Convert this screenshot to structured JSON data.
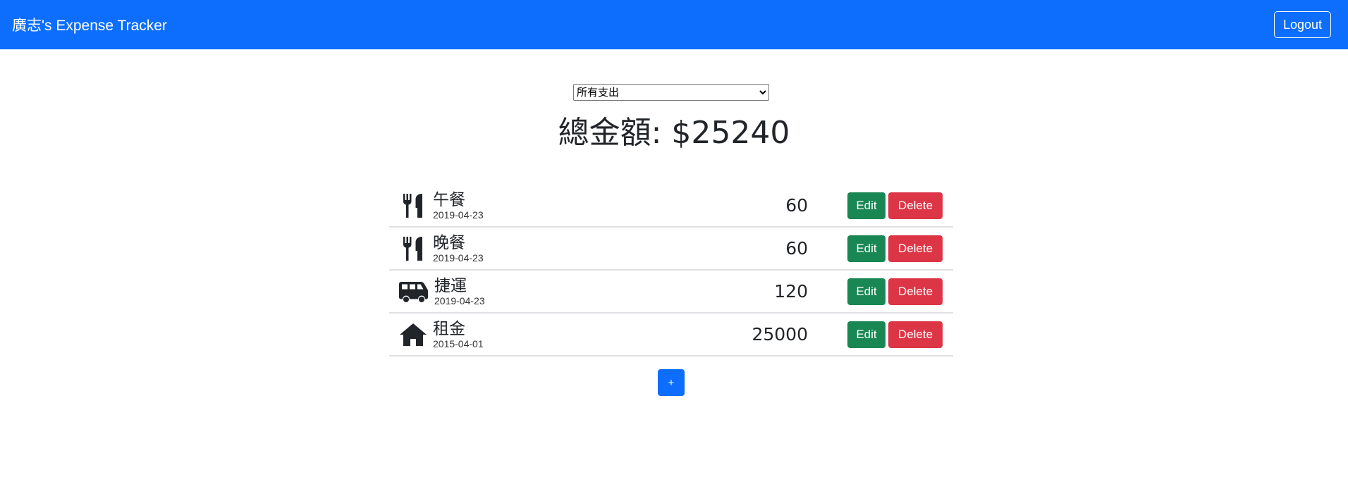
{
  "navbar": {
    "brand": "廣志's Expense Tracker",
    "logout_label": "Logout"
  },
  "filter": {
    "selected": "所有支出"
  },
  "total": {
    "text": "總金額: $25240"
  },
  "records": [
    {
      "icon": "utensils-icon",
      "name": "午餐",
      "date": "2019-04-23",
      "amount": "60",
      "edit_label": "Edit",
      "delete_label": "Delete"
    },
    {
      "icon": "utensils-icon",
      "name": "晚餐",
      "date": "2019-04-23",
      "amount": "60",
      "edit_label": "Edit",
      "delete_label": "Delete"
    },
    {
      "icon": "shuttle-van-icon",
      "name": "捷運",
      "date": "2019-04-23",
      "amount": "120",
      "edit_label": "Edit",
      "delete_label": "Delete"
    },
    {
      "icon": "home-icon",
      "name": "租金",
      "date": "2015-04-01",
      "amount": "25000",
      "edit_label": "Edit",
      "delete_label": "Delete"
    }
  ],
  "add_button": {
    "label": "+"
  },
  "colors": {
    "primary": "#0d6efd",
    "success": "#198754",
    "danger": "#dc3545"
  }
}
